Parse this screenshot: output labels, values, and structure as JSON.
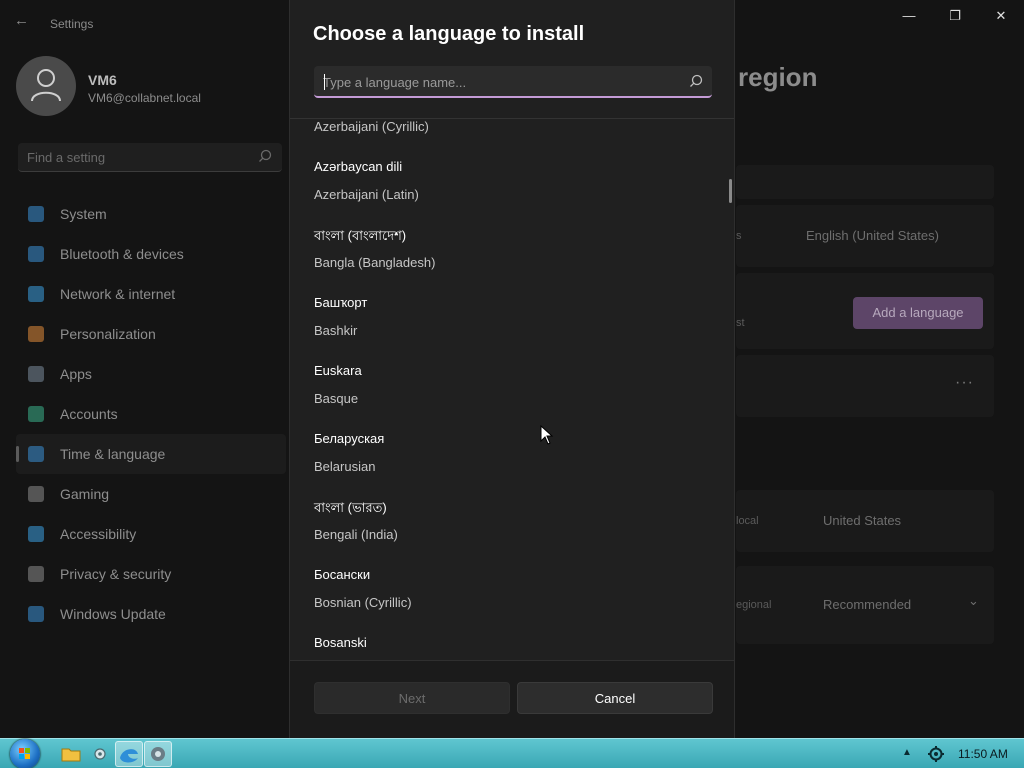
{
  "window": {
    "app_title": "Settings",
    "back_glyph": "←",
    "minimize_glyph": "—",
    "maximize_glyph": "❐",
    "close_glyph": "✕"
  },
  "profile": {
    "name": "VM6",
    "email": "VM6@collabnet.local"
  },
  "sidebar": {
    "search_placeholder": "Find a setting",
    "items": [
      {
        "label": "System",
        "icon": "system-icon",
        "color": "#3a8fd6"
      },
      {
        "label": "Bluetooth & devices",
        "icon": "bluetooth-icon",
        "color": "#3a8fd6"
      },
      {
        "label": "Network & internet",
        "icon": "network-icon",
        "color": "#3a9fe0"
      },
      {
        "label": "Personalization",
        "icon": "brush-icon",
        "color": "#e08a3a"
      },
      {
        "label": "Apps",
        "icon": "apps-icon",
        "color": "#7a8a9a"
      },
      {
        "label": "Accounts",
        "icon": "accounts-icon",
        "color": "#3ab08a"
      },
      {
        "label": "Time & language",
        "icon": "globe-clock-icon",
        "color": "#3a8fd6",
        "selected": true
      },
      {
        "label": "Gaming",
        "icon": "gaming-icon",
        "color": "#8a8a8a"
      },
      {
        "label": "Accessibility",
        "icon": "accessibility-icon",
        "color": "#3a9fe0"
      },
      {
        "label": "Privacy & security",
        "icon": "shield-icon",
        "color": "#8a8a8a"
      },
      {
        "label": "Windows Update",
        "icon": "update-icon",
        "color": "#3a8fd6"
      }
    ]
  },
  "main": {
    "page_title_fragment": "region",
    "display_language": "English (United States)",
    "add_language_label": "Add a language",
    "more_glyph": "···",
    "row_fragments": [
      "s",
      "st",
      "local",
      "egional"
    ],
    "country_value": "United States",
    "regional_format_value": "Recommended",
    "chevron": "⌄"
  },
  "dialog": {
    "title": "Choose a language to install",
    "search_placeholder": "Type a language name...",
    "partial_top_item": "Azerbaijani (Cyrillic)",
    "languages": [
      {
        "native": "Azərbaycan dili",
        "english": "Azerbaijani (Latin)"
      },
      {
        "native": "বাংলা (বাংলাদেশ)",
        "english": "Bangla (Bangladesh)"
      },
      {
        "native": "Башҡорт",
        "english": "Bashkir"
      },
      {
        "native": "Euskara",
        "english": "Basque"
      },
      {
        "native": "Беларуская",
        "english": "Belarusian"
      },
      {
        "native": "বাংলা (ভারত)",
        "english": "Bengali (India)"
      },
      {
        "native": "Босански",
        "english": "Bosnian (Cyrillic)"
      },
      {
        "native": "Bosanski",
        "english": ""
      }
    ],
    "next_label": "Next",
    "cancel_label": "Cancel",
    "accent_color": "#c49bd6"
  },
  "taskbar": {
    "clock": "11:50 AM",
    "apps": [
      "file-explorer-icon",
      "network-tool-icon",
      "edge-icon",
      "settings-app-icon"
    ]
  }
}
